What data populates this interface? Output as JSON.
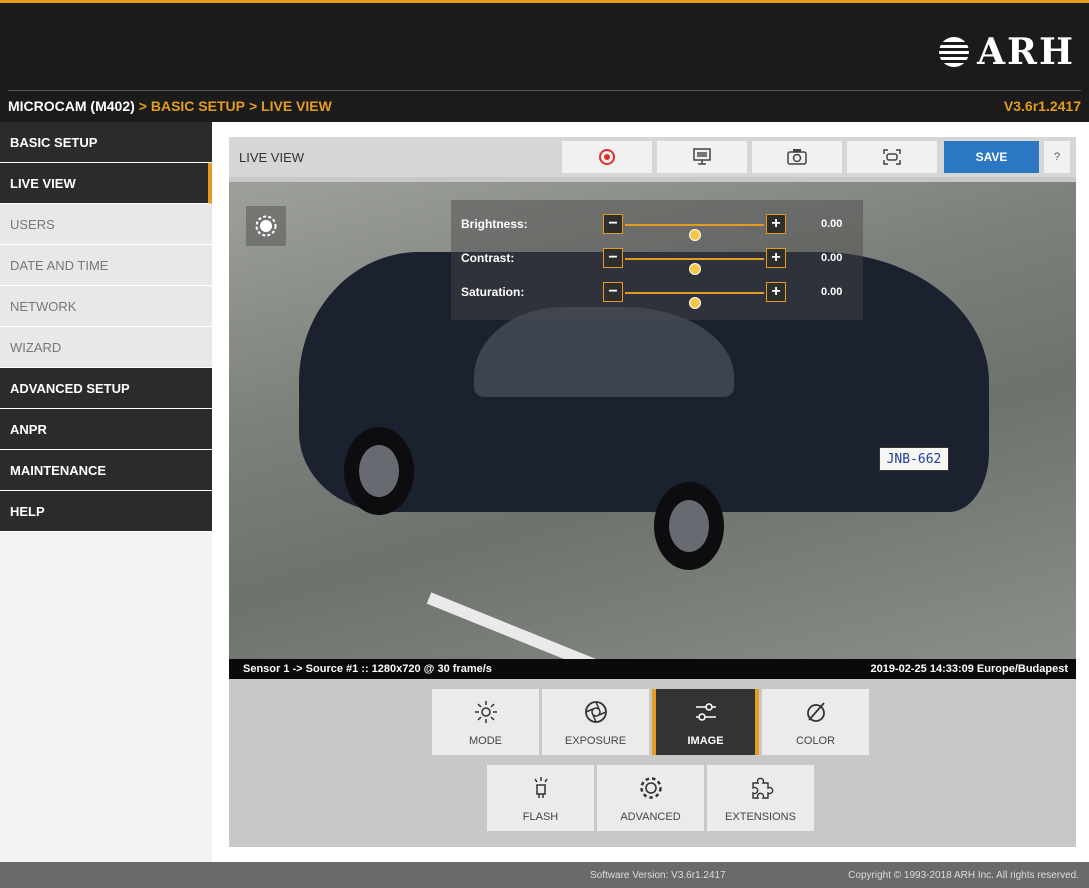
{
  "header": {
    "logo_text": "ARH",
    "breadcrumb": {
      "root": "MICROCAM (M402)",
      "parts": [
        "> BASIC SETUP",
        "> LIVE VIEW"
      ]
    },
    "version": "V3.6r1.2417"
  },
  "sidebar": {
    "items": [
      {
        "label": "BASIC SETUP",
        "style": "section"
      },
      {
        "label": "LIVE VIEW",
        "style": "active"
      },
      {
        "label": "USERS",
        "style": "sub"
      },
      {
        "label": "DATE AND TIME",
        "style": "sub"
      },
      {
        "label": "NETWORK",
        "style": "sub"
      },
      {
        "label": "WIZARD",
        "style": "sub"
      },
      {
        "label": "ADVANCED SETUP",
        "style": "section"
      },
      {
        "label": "ANPR",
        "style": "section"
      },
      {
        "label": "MAINTENANCE",
        "style": "section"
      },
      {
        "label": "HELP",
        "style": "section"
      }
    ]
  },
  "toolbar": {
    "title": "LIVE VIEW",
    "save_label": "SAVE",
    "help_label": "?",
    "icons": [
      "record-icon",
      "display-icon",
      "camera-icon",
      "scan-frame-icon"
    ]
  },
  "adjustments": {
    "brightness": {
      "label": "Brightness:",
      "value": "0.00",
      "level": 0.5
    },
    "contrast": {
      "label": "Contrast:",
      "value": "0.00",
      "level": 0.5
    },
    "saturation": {
      "label": "Saturation:",
      "value": "0.00",
      "level": 0.5
    }
  },
  "live": {
    "plate": "JNB-662"
  },
  "status": {
    "source": "Sensor 1 -> Source #1 :: 1280x720 @ 30 frame/s",
    "timestamp": "2019-02-25 14:33:09 Europe/Budapest"
  },
  "controls": {
    "mode": "MODE",
    "exposure": "EXPOSURE",
    "image": "IMAGE",
    "color": "COLOR",
    "flash": "FLASH",
    "advanced": "ADVANCED",
    "extensions": "EXTENSIONS"
  },
  "footer": {
    "software_version": "Software Version:  V3.6r1.2417",
    "copyright": "Copyright © 1993-2018 ARH Inc. All rights reserved."
  },
  "colors": {
    "accent": "#e49c20",
    "save": "#2b77c2",
    "record": "#e0302a"
  }
}
